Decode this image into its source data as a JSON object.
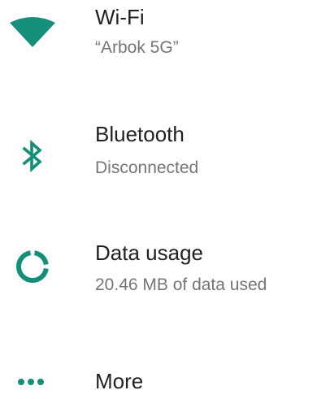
{
  "colors": {
    "accent": "#138f7a",
    "title_text": "#212121",
    "subtitle_text": "#757575",
    "background": "#ffffff"
  },
  "settings": {
    "items": [
      {
        "icon": "wifi-icon",
        "title": "Wi-Fi",
        "subtitle": "“Arbok 5G”"
      },
      {
        "icon": "bluetooth-icon",
        "title": "Bluetooth",
        "subtitle": "Disconnected"
      },
      {
        "icon": "data-usage-icon",
        "title": "Data usage",
        "subtitle": "20.46 MB of data used"
      },
      {
        "icon": "more-icon",
        "title": "More"
      }
    ]
  }
}
